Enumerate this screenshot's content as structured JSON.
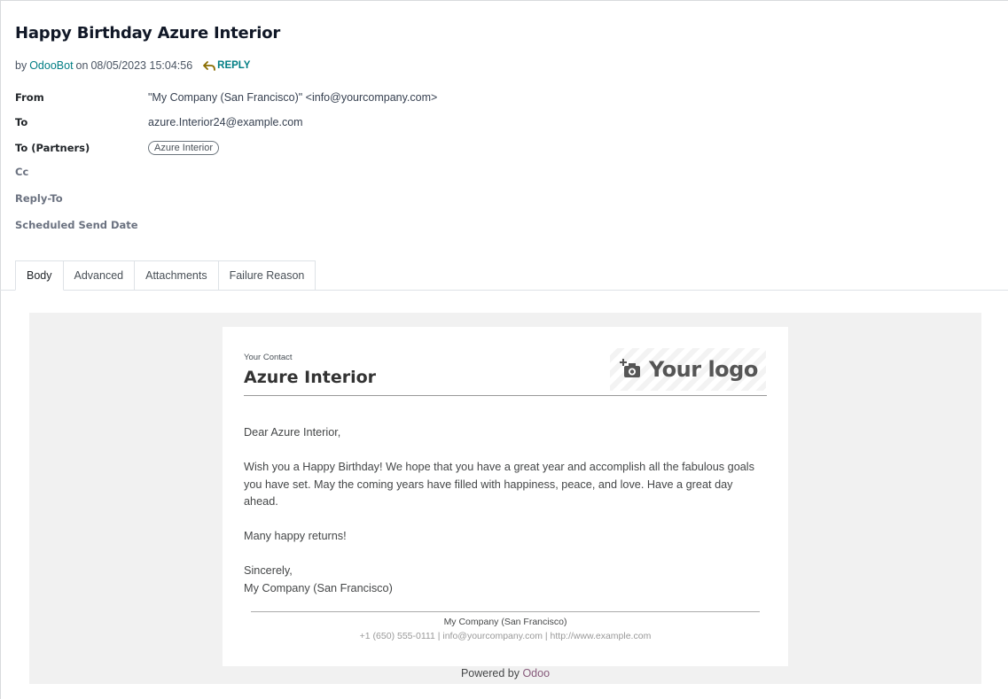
{
  "header": {
    "title": "Happy Birthday Azure Interior",
    "by": "by",
    "author": "OdooBot",
    "on": "on",
    "date": "08/05/2023 15:04:56",
    "reply_label": "REPLY"
  },
  "fields": {
    "from_label": "From",
    "from_value": "\"My Company (San Francisco)\" <info@yourcompany.com>",
    "to_label": "To",
    "to_value": "azure.Interior24@example.com",
    "to_partners_label": "To (Partners)",
    "to_partners_tag": "Azure Interior",
    "cc_label": "Cc",
    "reply_to_label": "Reply-To",
    "scheduled_label": "Scheduled Send Date"
  },
  "tabs": [
    {
      "label": "Body",
      "active": true
    },
    {
      "label": "Advanced",
      "active": false
    },
    {
      "label": "Attachments",
      "active": false
    },
    {
      "label": "Failure Reason",
      "active": false
    }
  ],
  "email": {
    "contact_label": "Your Contact",
    "contact_name": "Azure Interior",
    "logo_text": "Your logo",
    "greeting": "Dear Azure Interior,",
    "paragraph": "Wish you a Happy Birthday! We hope that you have a great year and accomplish all the fabulous goals you have set. May the coming years have filled with happiness, peace, and love. Have a great day ahead.",
    "wishes": "Many happy returns!",
    "closing": "Sincerely,",
    "signature": "My Company (San Francisco)",
    "footer_company": "My Company (San Francisco)",
    "footer_contact": "+1 (650) 555-0111 | info@yourcompany.com | http://www.example.com"
  },
  "powered": {
    "prefix": "Powered by",
    "brand": "Odoo"
  },
  "colors": {
    "accent": "#017e84",
    "brand": "#875a7b"
  },
  "icons": {
    "reply": "reply-icon",
    "logo": "camera-plus-icon"
  }
}
